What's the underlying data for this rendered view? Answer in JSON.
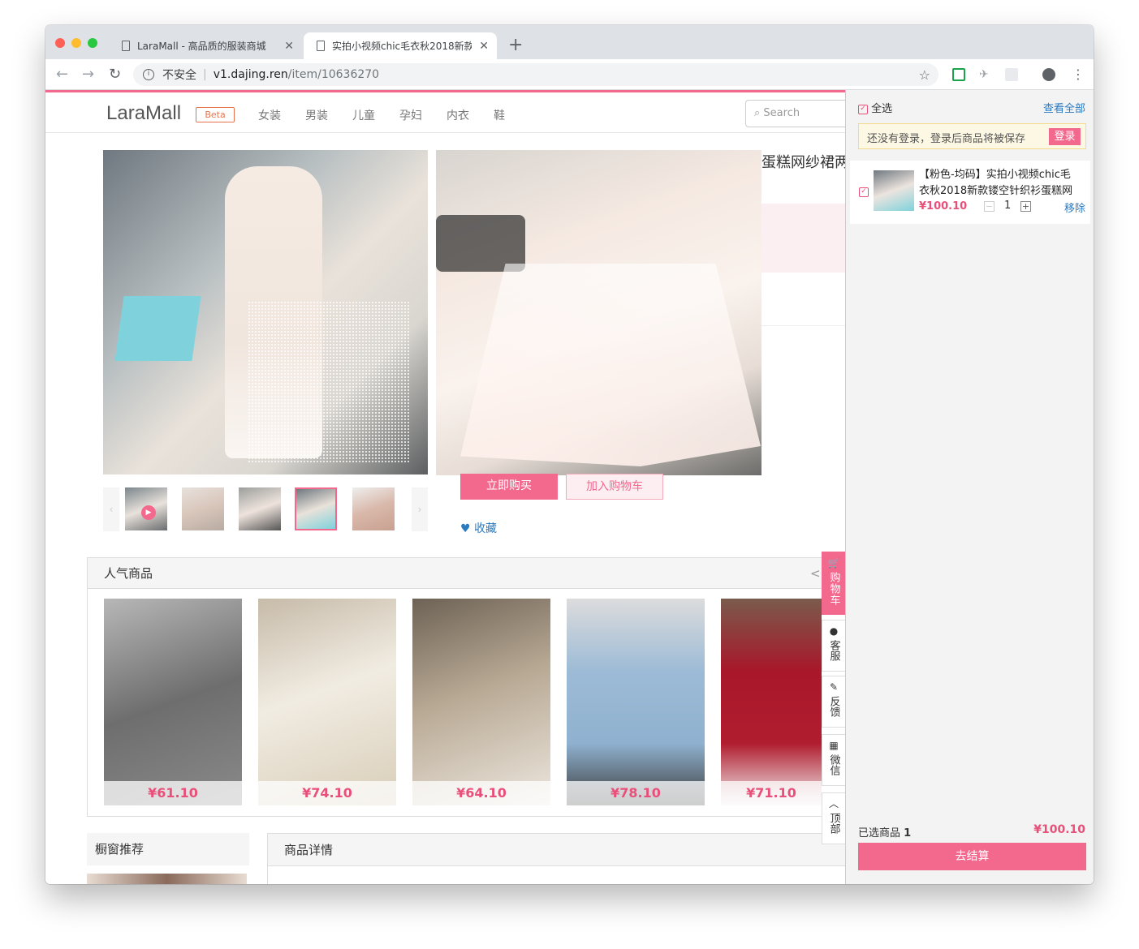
{
  "browser": {
    "tabs": [
      {
        "title": "LaraMall - 高品质的服装商城",
        "active": false
      },
      {
        "title": "实拍小视频chic毛衣秋2018新款",
        "active": true
      }
    ],
    "url_security": "不安全",
    "url_host": "v1.dajing.ren",
    "url_path": "/item/10636270",
    "new_tab": "+"
  },
  "site": {
    "logo": "LaraMall",
    "badge": "Beta",
    "nav": [
      "女装",
      "男装",
      "儿童",
      "孕妇",
      "内衣",
      "鞋"
    ],
    "search_placeholder": "Search"
  },
  "product": {
    "title_fragment": "蛋糕网纱裙两",
    "buy_now": "立即购买",
    "add_to_cart": "加入购物车",
    "favorite": "收藏",
    "thumb_count": 5,
    "selected_thumb": 4
  },
  "popular": {
    "heading": "人气商品",
    "pager_prev": "<",
    "items": [
      {
        "price": "¥61.10",
        "color": "#6e6e6e"
      },
      {
        "price": "¥74.10",
        "color": "#e8e2d3"
      },
      {
        "price": "¥64.10",
        "color": "#a89a86"
      },
      {
        "price": "¥78.10",
        "color": "#9dbbd6"
      },
      {
        "price": "¥71.10",
        "color": "#a8172a"
      }
    ]
  },
  "showcase": {
    "heading": "橱窗推荐"
  },
  "details": {
    "heading": "商品详情"
  },
  "side_tabs": [
    {
      "icon": "cart-icon",
      "glyph": "🛒",
      "label": "购物车"
    },
    {
      "icon": "qq-icon",
      "glyph": "●",
      "label": "客服"
    },
    {
      "icon": "edit-icon",
      "glyph": "✎",
      "label": "反馈"
    },
    {
      "icon": "qrcode-icon",
      "glyph": "▦",
      "label": "微信"
    },
    {
      "icon": "arrow-up-icon",
      "glyph": "︿",
      "label": "顶部"
    }
  ],
  "cart": {
    "select_all": "全选",
    "view_all": "查看全部",
    "login_notice": "还没有登录，登录后商品将被保存",
    "login_button": "登录",
    "item": {
      "title_line1": "【粉色-均码】实拍小视频chic毛",
      "title_line2": "衣秋2018新款镂空针织衫蛋糕网",
      "price": "¥100.10",
      "quantity": "1",
      "remove": "移除"
    },
    "selected_label": "已选商品",
    "selected_count": "1",
    "total": "¥100.10",
    "checkout": "去结算"
  },
  "colors": {
    "accent": "#f3698e",
    "price": "#e8507a",
    "link": "#2a7ac0"
  }
}
